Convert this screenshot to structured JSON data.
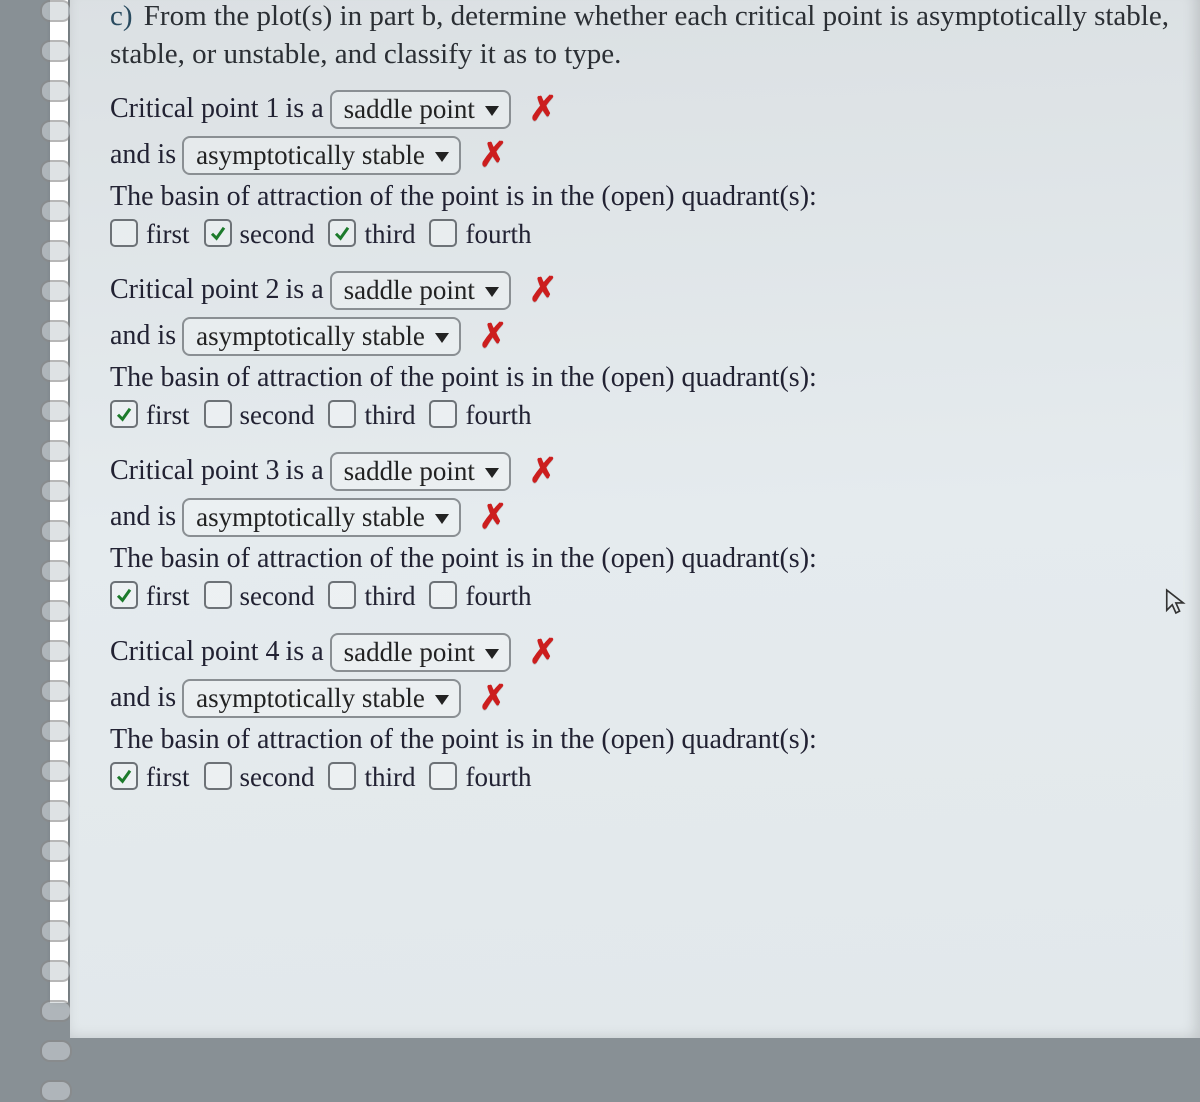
{
  "part_label": "c)",
  "prompt": "From the plot(s) in part b, determine whether each critical point is asymptotically stable, stable, or unstable, and classify it as to type.",
  "basin_text": "The basin of attraction of the point is in the (open) quadrant(s):",
  "labels": {
    "is_a": "is a",
    "and_is": "and is",
    "first": "first",
    "second": "second",
    "third": "third",
    "fourth": "fourth"
  },
  "critical_points": [
    {
      "title": "Critical point 1",
      "type_selected": "saddle point",
      "type_marked_wrong": true,
      "stability_selected": "asymptotically stable",
      "stability_marked_wrong": true,
      "quadrants": {
        "first": false,
        "second": true,
        "third": true,
        "fourth": false
      }
    },
    {
      "title": "Critical point 2",
      "type_selected": "saddle point",
      "type_marked_wrong": true,
      "stability_selected": "asymptotically stable",
      "stability_marked_wrong": true,
      "quadrants": {
        "first": true,
        "second": false,
        "third": false,
        "fourth": false
      }
    },
    {
      "title": "Critical point 3",
      "type_selected": "saddle point",
      "type_marked_wrong": true,
      "stability_selected": "asymptotically stable",
      "stability_marked_wrong": true,
      "quadrants": {
        "first": true,
        "second": false,
        "third": false,
        "fourth": false
      }
    },
    {
      "title": "Critical point 4",
      "type_selected": "saddle point",
      "type_marked_wrong": true,
      "stability_selected": "asymptotically stable",
      "stability_marked_wrong": true,
      "quadrants": {
        "first": true,
        "second": false,
        "third": false,
        "fourth": false
      }
    }
  ]
}
